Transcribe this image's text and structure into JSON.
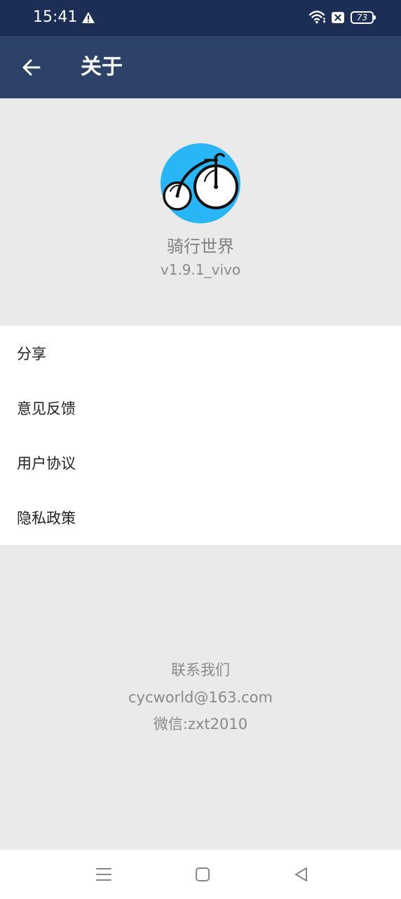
{
  "status_bar": {
    "time": "15:41",
    "battery": "73"
  },
  "app_bar": {
    "title": "关于"
  },
  "about": {
    "app_name": "骑行世界",
    "version": "v1.9.1_vivo"
  },
  "menu": {
    "items": [
      {
        "label": "分享"
      },
      {
        "label": "意见反馈"
      },
      {
        "label": "用户协议"
      },
      {
        "label": "隐私政策"
      }
    ]
  },
  "contact": {
    "heading": "联系我们",
    "email": "cycworld@163.com",
    "wechat": "微信:zxt2010"
  },
  "colors": {
    "status_bar_bg": "#1c2e55",
    "app_bar_bg": "#2d4268",
    "logo_bg": "#29b6f6",
    "page_bg": "#eaeaea"
  }
}
